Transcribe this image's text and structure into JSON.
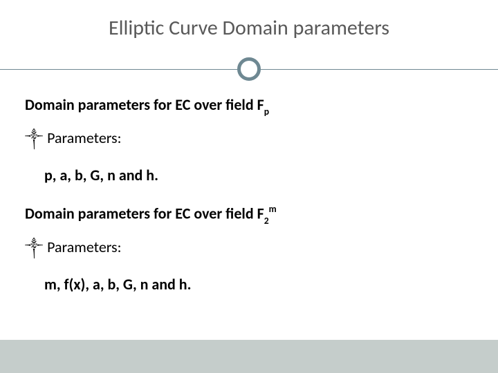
{
  "title": "Elliptic Curve Domain parameters",
  "section1": {
    "heading_prefix": "Domain parameters for EC over field F",
    "heading_sub": "p",
    "bullet_label": "Parameters:",
    "params": "p, a, b, G, n and h."
  },
  "section2": {
    "heading_prefix": "Domain parameters for EC over field F",
    "heading_sub": "2",
    "heading_sup": "m",
    "bullet_label": "Parameters:",
    "params": "m, f(x), a, b, G, n and h."
  },
  "bullet_glyph": "༒"
}
